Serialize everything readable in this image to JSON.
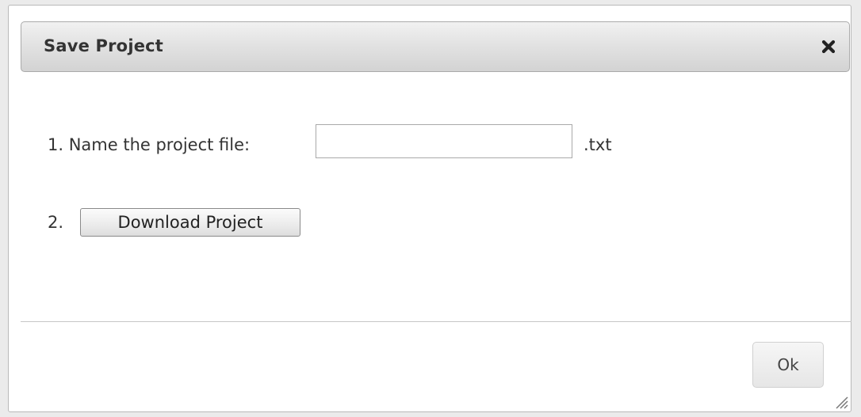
{
  "dialog": {
    "title": "Save Project",
    "close_icon": "close-x-icon",
    "step1": {
      "label": "1. Name the project file:",
      "input_value": "",
      "input_placeholder": "",
      "extension": ".txt"
    },
    "step2": {
      "label": "2.",
      "button_label": "Download Project"
    },
    "ok_label": "Ok",
    "resize_icon": "resize-grip-icon"
  }
}
